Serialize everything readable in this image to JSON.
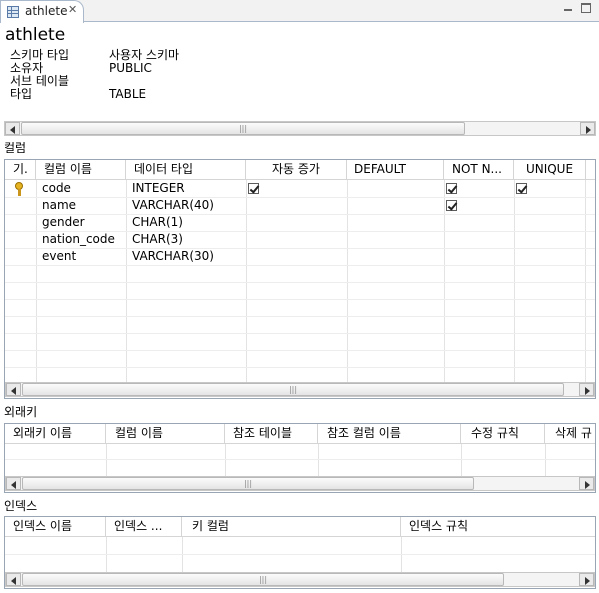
{
  "tab": {
    "label": "athlete",
    "close": "✕"
  },
  "heading": "athlete",
  "props": [
    {
      "key": "스키마 타입",
      "value": "사용자 스키마"
    },
    {
      "key": "소유자",
      "value": "PUBLIC"
    },
    {
      "key": "서브 테이블",
      "value": ""
    },
    {
      "key": "타입",
      "value": "TABLE"
    }
  ],
  "columns_section": {
    "label": "컬럼",
    "headers": [
      "기.",
      "컬럼 이름",
      "데이터 타입",
      "자동 증가",
      "DEFAULT",
      "NOT N...",
      "UNIQUE"
    ],
    "rows": [
      {
        "pk": true,
        "name": "code",
        "type": "INTEGER",
        "auto_increment": true,
        "default": "",
        "not_null": true,
        "unique": true
      },
      {
        "pk": false,
        "name": "name",
        "type": "VARCHAR(40)",
        "auto_increment": false,
        "default": "",
        "not_null": true,
        "unique": false
      },
      {
        "pk": false,
        "name": "gender",
        "type": "CHAR(1)",
        "auto_increment": false,
        "default": "",
        "not_null": false,
        "unique": false
      },
      {
        "pk": false,
        "name": "nation_code",
        "type": "CHAR(3)",
        "auto_increment": false,
        "default": "",
        "not_null": false,
        "unique": false
      },
      {
        "pk": false,
        "name": "event",
        "type": "VARCHAR(30)",
        "auto_increment": false,
        "default": "",
        "not_null": false,
        "unique": false
      }
    ]
  },
  "foreign_keys_section": {
    "label": "외래키",
    "headers": [
      "외래키 이름",
      "컬럼 이름",
      "참조 테이블",
      "참조 컬럼 이름",
      "수정 규칙",
      "삭제 규"
    ]
  },
  "indexes_section": {
    "label": "인덱스",
    "headers": [
      "인덱스 이름",
      "인덱스 ...",
      "키 컬럼",
      "인덱스 규칙"
    ]
  }
}
